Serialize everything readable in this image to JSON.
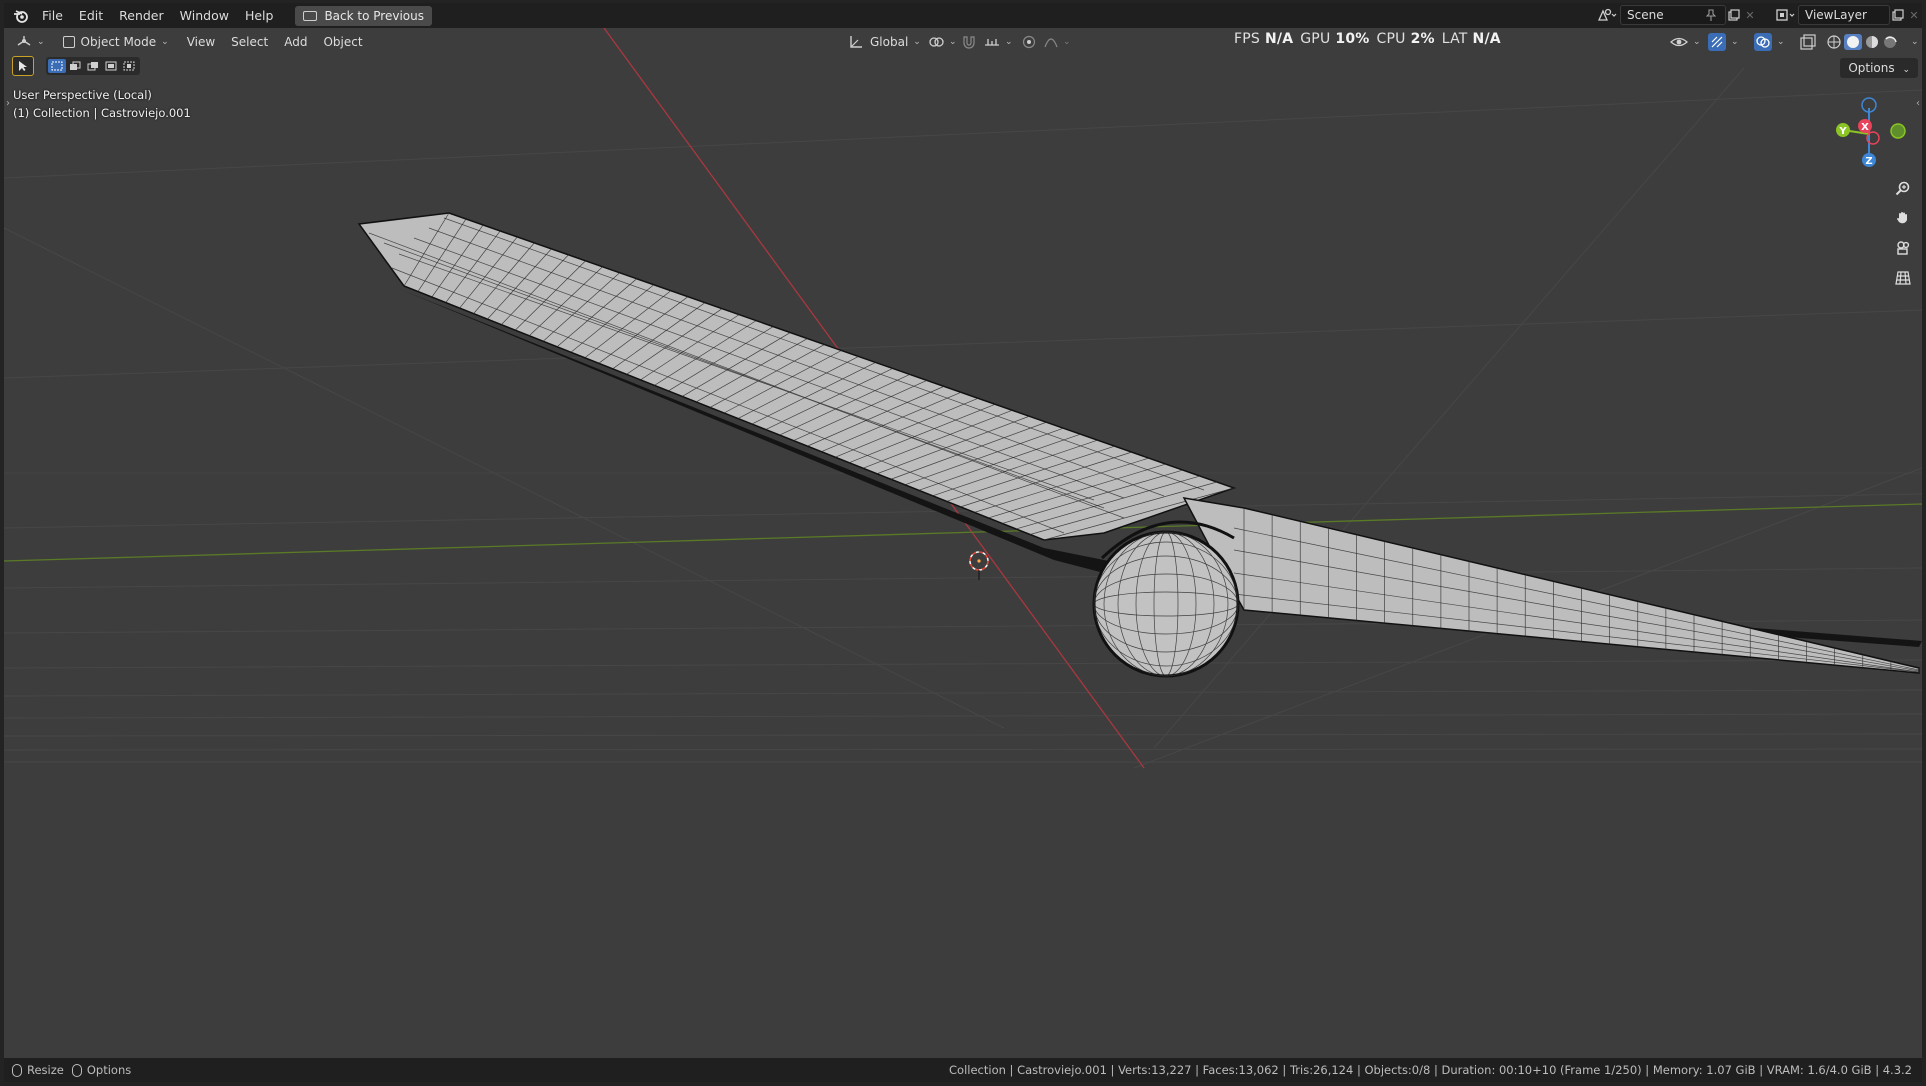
{
  "topbar": {
    "menus": [
      "File",
      "Edit",
      "Render",
      "Window",
      "Help"
    ],
    "back_button": "Back to Previous",
    "scene": "Scene",
    "view_layer": "ViewLayer"
  },
  "viewport_header": {
    "mode": "Object Mode",
    "menus": [
      "View",
      "Select",
      "Add",
      "Object"
    ],
    "orientation": "Global",
    "options": "Options"
  },
  "stats": {
    "fps_label": "FPS",
    "fps_value": "N/A",
    "gpu_label": "GPU",
    "gpu_value": "10%",
    "cpu_label": "CPU",
    "cpu_value": "2%",
    "lat_label": "LAT",
    "lat_value": "N/A"
  },
  "overlay": {
    "view_name": "User Perspective (Local)",
    "collection_info": "(1) Collection | Castroviejo.001"
  },
  "gizmo": {
    "x_label": "X",
    "y_label": "Y",
    "z_label": "Z",
    "x_color": "#e8435a",
    "y_color": "#8bc424",
    "z_color": "#3e86d6"
  },
  "statusbar": {
    "left_items": [
      "Resize",
      "Options"
    ],
    "info": "Collection | Castroviejo.001 | Verts:13,227 | Faces:13,062 | Tris:26,124 | Objects:0/8 | Duration: 00:10+10 (Frame 1/250) | Memory: 1.07 GiB | VRAM: 1.6/4.0 GiB | 4.3.2"
  },
  "colors": {
    "viewport_bg": "#3d3d3d",
    "x_axis": "#a8383f",
    "y_axis": "#5a7a26",
    "mesh_fill": "#bcbcbc",
    "wire": "#1a1a1a"
  }
}
